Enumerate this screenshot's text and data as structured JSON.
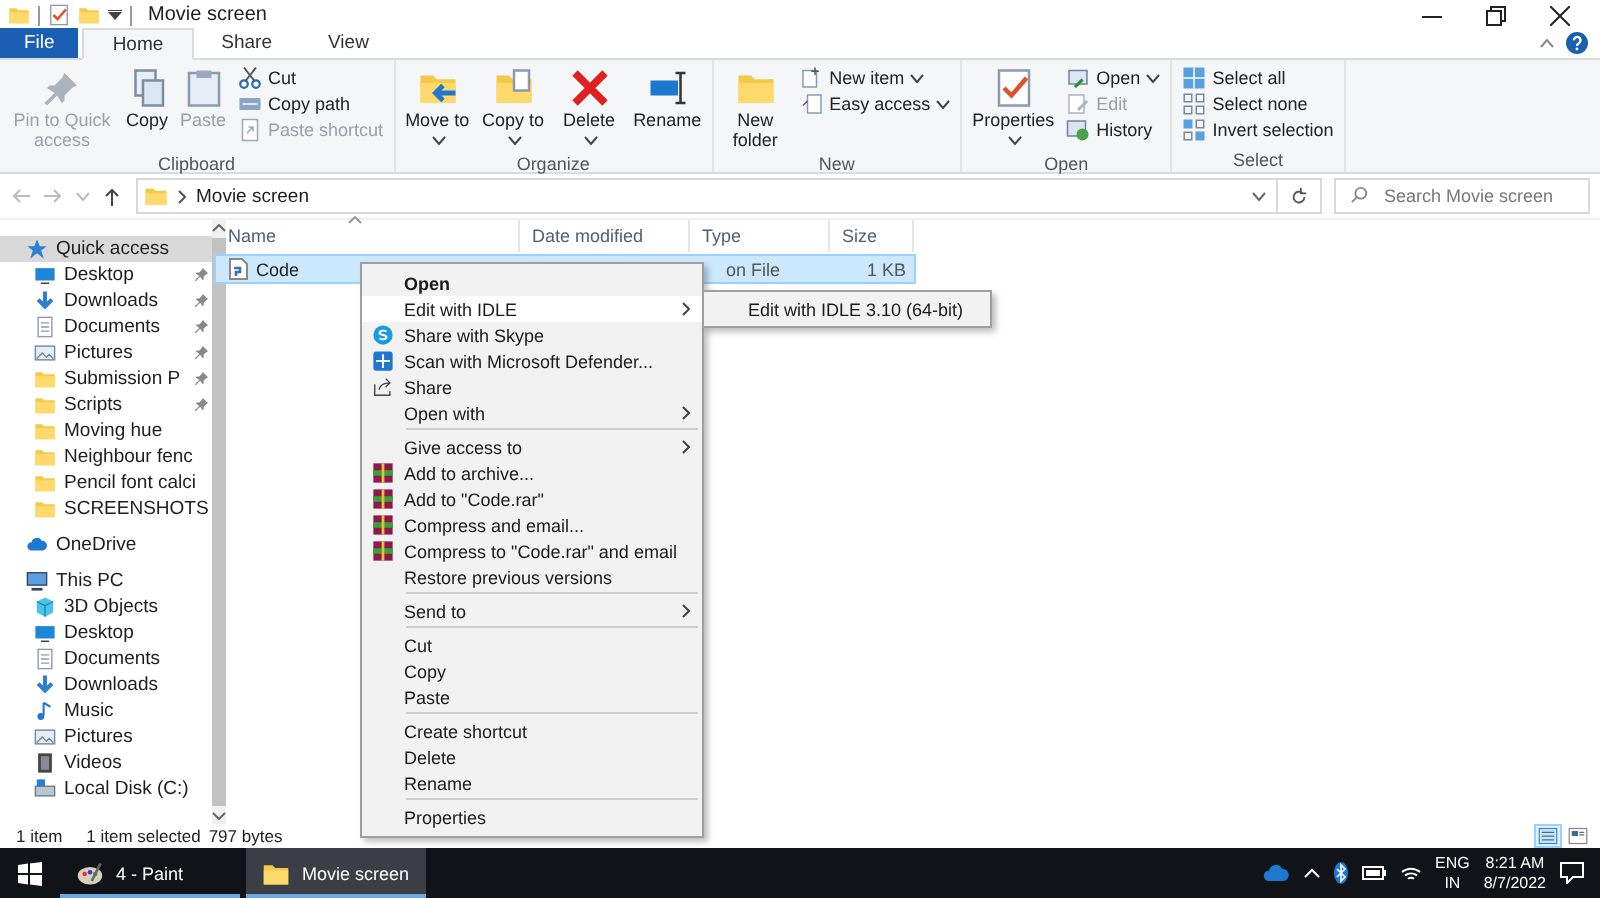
{
  "title_bar": {
    "title": "Movie screen"
  },
  "ribbon": {
    "tabs": [
      {
        "label": "File",
        "kind": "file",
        "selected": false
      },
      {
        "label": "Home",
        "kind": "tab",
        "selected": true
      },
      {
        "label": "Share",
        "kind": "tab",
        "selected": false
      },
      {
        "label": "View",
        "kind": "tab",
        "selected": false
      }
    ],
    "groups": [
      {
        "label": "Clipboard",
        "buttons": [
          {
            "label": "Pin to Quick access",
            "kind": "pin",
            "disabled": true,
            "dropdown": false
          },
          {
            "label": "Copy",
            "kind": "copy",
            "disabled": false,
            "dropdown": false
          },
          {
            "label": "Paste",
            "kind": "paste",
            "disabled": true,
            "dropdown": false
          }
        ],
        "small_buttons": [
          {
            "label": "Cut",
            "kind": "cut",
            "disabled": false,
            "dropdown": false
          },
          {
            "label": "Copy path",
            "kind": "path",
            "disabled": false,
            "dropdown": false
          },
          {
            "label": "Paste shortcut",
            "kind": "shortcut",
            "disabled": true,
            "dropdown": false
          }
        ]
      },
      {
        "label": "Organize",
        "buttons": [
          {
            "label": "Move to",
            "kind": "move",
            "disabled": false,
            "dropdown": true
          },
          {
            "label": "Copy to",
            "kind": "copyto",
            "disabled": false,
            "dropdown": true
          },
          {
            "label": "Delete",
            "kind": "delete",
            "disabled": false,
            "dropdown": true
          },
          {
            "label": "Rename",
            "kind": "rename",
            "disabled": false,
            "dropdown": false
          }
        ]
      },
      {
        "label": "New",
        "buttons": [
          {
            "label": "New folder",
            "kind": "folder",
            "disabled": false,
            "dropdown": false
          }
        ],
        "small_buttons": [
          {
            "label": "New item",
            "kind": "newitem",
            "disabled": false,
            "dropdown": true
          },
          {
            "label": "Easy access",
            "kind": "easy",
            "disabled": false,
            "dropdown": true
          }
        ]
      },
      {
        "label": "Open",
        "buttons": [
          {
            "label": "Properties",
            "kind": "properties",
            "disabled": false,
            "dropdown": true
          }
        ],
        "small_buttons": [
          {
            "label": "Open",
            "kind": "open",
            "disabled": false,
            "dropdown": true
          },
          {
            "label": "Edit",
            "kind": "edit",
            "disabled": true,
            "dropdown": false
          },
          {
            "label": "History",
            "kind": "history",
            "disabled": false,
            "dropdown": false
          }
        ]
      },
      {
        "label": "Select",
        "small_buttons": [
          {
            "label": "Select all",
            "kind": "selectall",
            "disabled": false,
            "dropdown": false
          },
          {
            "label": "Select none",
            "kind": "selectnone",
            "disabled": false,
            "dropdown": false
          },
          {
            "label": "Invert selection",
            "kind": "invert",
            "disabled": false,
            "dropdown": false
          }
        ]
      }
    ]
  },
  "address_bar": {
    "path": [
      "Movie screen"
    ],
    "search": {
      "placeholder": "Search Movie screen"
    }
  },
  "navigation": [
    {
      "label": "Quick access",
      "kind": "star",
      "selected": true,
      "children": [
        {
          "label": "Desktop",
          "kind": "desktop",
          "pinned": true,
          "selected": false
        },
        {
          "label": "Downloads",
          "kind": "downloads",
          "pinned": true,
          "selected": false
        },
        {
          "label": "Documents",
          "kind": "documents",
          "pinned": true,
          "selected": false
        },
        {
          "label": "Pictures",
          "kind": "pictures",
          "pinned": true,
          "selected": false
        },
        {
          "label": "Submission P",
          "kind": "folder",
          "pinned": true,
          "selected": false
        },
        {
          "label": "Scripts",
          "kind": "folder",
          "pinned": true,
          "selected": false
        },
        {
          "label": "Moving hue",
          "kind": "folder",
          "pinned": false,
          "selected": false
        },
        {
          "label": "Neighbour fenc",
          "kind": "folder",
          "pinned": false,
          "selected": false
        },
        {
          "label": "Pencil font calci",
          "kind": "folder",
          "pinned": false,
          "selected": false
        },
        {
          "label": "SCREENSHOTS",
          "kind": "folder",
          "pinned": false,
          "selected": false
        }
      ]
    },
    {
      "label": "OneDrive",
      "kind": "cloud",
      "selected": false
    },
    {
      "label": "This PC",
      "kind": "pc",
      "selected": false,
      "children": [
        {
          "label": "3D Objects",
          "kind": "objects",
          "pinned": false,
          "selected": false
        },
        {
          "label": "Desktop",
          "kind": "desktop",
          "pinned": false,
          "selected": false
        },
        {
          "label": "Documents",
          "kind": "documents",
          "pinned": false,
          "selected": false
        },
        {
          "label": "Downloads",
          "kind": "downloads",
          "pinned": false,
          "selected": false
        },
        {
          "label": "Music",
          "kind": "music",
          "pinned": false,
          "selected": false
        },
        {
          "label": "Pictures",
          "kind": "pictures",
          "pinned": false,
          "selected": false
        },
        {
          "label": "Videos",
          "kind": "videos",
          "pinned": false,
          "selected": false
        },
        {
          "label": "Local Disk (C:)",
          "kind": "drive",
          "pinned": false,
          "selected": false
        }
      ]
    }
  ],
  "file_list": {
    "columns": [
      "Name",
      "Date modified",
      "Type",
      "Size"
    ],
    "rows": [
      {
        "name": "Code",
        "type": "on File",
        "size": "1 KB",
        "selected": true
      }
    ]
  },
  "context_menu": {
    "sections": [
      [
        {
          "label": "Open",
          "kind": "plain",
          "default": true,
          "submenu": false,
          "selected": false
        },
        {
          "label": "Edit with IDLE",
          "kind": "plain",
          "default": false,
          "submenu": true,
          "selected": true
        },
        {
          "label": "Share with Skype",
          "kind": "skype",
          "default": false,
          "submenu": false,
          "selected": false
        },
        {
          "label": "Scan with Microsoft Defender...",
          "kind": "defender",
          "default": false,
          "submenu": false,
          "selected": false
        },
        {
          "label": "Share",
          "kind": "share",
          "default": false,
          "submenu": false,
          "selected": false
        },
        {
          "label": "Open with",
          "kind": "plain",
          "default": false,
          "submenu": true,
          "selected": false
        }
      ],
      [
        {
          "label": "Give access to",
          "kind": "plain",
          "default": false,
          "submenu": true,
          "selected": false
        },
        {
          "label": "Add to archive...",
          "kind": "archive",
          "default": false,
          "submenu": false,
          "selected": false
        },
        {
          "label": "Add to \"Code.rar\"",
          "kind": "archive",
          "default": false,
          "submenu": false,
          "selected": false
        },
        {
          "label": "Compress and email...",
          "kind": "archive",
          "default": false,
          "submenu": false,
          "selected": false
        },
        {
          "label": "Compress to \"Code.rar\" and email",
          "kind": "archive",
          "default": false,
          "submenu": false,
          "selected": false
        },
        {
          "label": "Restore previous versions",
          "kind": "plain",
          "default": false,
          "submenu": false,
          "selected": false
        }
      ],
      [
        {
          "label": "Send to",
          "kind": "plain",
          "default": false,
          "submenu": true,
          "selected": false
        }
      ],
      [
        {
          "label": "Cut",
          "kind": "plain",
          "default": false,
          "submenu": false,
          "selected": false
        },
        {
          "label": "Copy",
          "kind": "plain",
          "default": false,
          "submenu": false,
          "selected": false
        },
        {
          "label": "Paste",
          "kind": "plain",
          "default": false,
          "submenu": false,
          "selected": false
        }
      ],
      [
        {
          "label": "Create shortcut",
          "kind": "plain",
          "default": false,
          "submenu": false,
          "selected": false
        },
        {
          "label": "Delete",
          "kind": "plain",
          "default": false,
          "submenu": false,
          "selected": false
        },
        {
          "label": "Rename",
          "kind": "plain",
          "default": false,
          "submenu": false,
          "selected": false
        }
      ],
      [
        {
          "label": "Properties",
          "kind": "plain",
          "default": false,
          "submenu": false,
          "selected": false
        }
      ]
    ]
  },
  "submenu": {
    "items": [
      {
        "label": "Edit with IDLE 3.10 (64-bit)"
      }
    ]
  },
  "status_bar": {
    "item_count": "1 item",
    "selection": "1 item selected",
    "size": "797 bytes",
    "views": [
      {
        "kind": "details",
        "selected": true
      },
      {
        "kind": "tiles",
        "selected": false
      }
    ]
  },
  "taskbar": {
    "apps": [
      {
        "label": "4 - Paint",
        "kind": "paint",
        "selected": false
      },
      {
        "label": "Movie screen",
        "kind": "folder",
        "selected": true
      }
    ],
    "language": "ENG",
    "region": "IN",
    "time": "8:21 AM",
    "date": "8/7/2022"
  }
}
